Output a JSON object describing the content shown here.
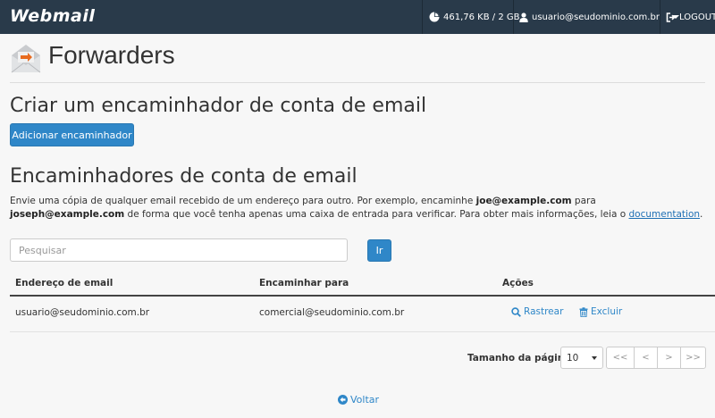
{
  "topbar": {
    "logo": "Webmail",
    "disk_usage": "461,76 KB / 2 GB",
    "user": "usuario@seudominio.com.br",
    "logout": "LOGOUT"
  },
  "page": {
    "title": "Forwarders"
  },
  "create_section": {
    "heading": "Criar um encaminhador de conta de email",
    "add_button": "Adicionar encaminhador"
  },
  "list_section": {
    "heading": "Encaminhadores de conta de email",
    "desc_1": "Envie uma cópia de qualquer email recebido de um endereço para outro. Por exemplo, encaminhe ",
    "desc_email_1": "joe@example.com",
    "desc_2": " para ",
    "desc_email_2": "joseph@example.com",
    "desc_3": " de forma que você tenha apenas uma caixa de entrada para verificar. Para obter mais informações, leia o ",
    "desc_link": "documentation",
    "desc_4": "."
  },
  "search": {
    "placeholder": "Pesquisar",
    "go_button": "Ir"
  },
  "table": {
    "headers": [
      "Endereço de email",
      "Encaminhar para",
      "Ações"
    ],
    "rows": [
      {
        "address": "usuario@seudominio.com.br",
        "forward_to": "comercial@seudominio.com.br",
        "trace_label": "Rastrear",
        "delete_label": "Excluir"
      }
    ]
  },
  "pagination": {
    "page_size_label": "Tamanho da página",
    "page_size_value": "10",
    "first": "<<",
    "prev": "<",
    "next": ">",
    "last": ">>"
  },
  "footer": {
    "back_label": "Voltar"
  },
  "icons": {
    "disk": "pie-chart-icon",
    "user": "user-icon",
    "logout": "sign-out-icon",
    "page": "forwarder-envelope-icon",
    "trace": "search-icon",
    "delete": "trash-icon",
    "back": "arrow-circle-left-icon"
  },
  "colors": {
    "topbar_bg": "#293a4a",
    "primary": "#2f87c8",
    "page_bg": "#f7f7f7"
  }
}
